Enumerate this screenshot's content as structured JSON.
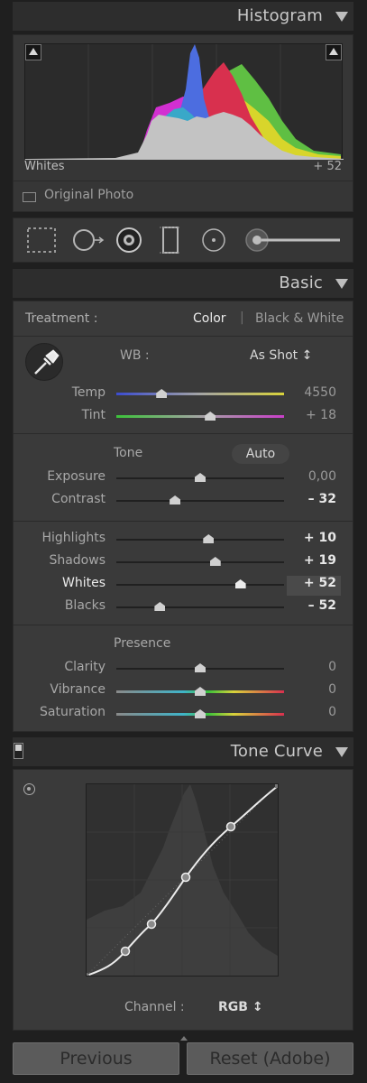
{
  "histogram": {
    "title": "Histogram",
    "info_label": "Whites",
    "info_value": "+ 52",
    "original_photo_label": "Original Photo"
  },
  "tools": [
    "crop-overlay-icon",
    "spot-removal-icon",
    "red-eye-icon",
    "graduated-filter-icon",
    "radial-filter-icon",
    "adjustment-brush-icon"
  ],
  "basic": {
    "title": "Basic",
    "treatment_label": "Treatment :",
    "treatment_color": "Color",
    "treatment_separator": "|",
    "treatment_bw": "Black & White",
    "wb_label": "WB :",
    "wb_value": "As Shot ↕",
    "tone_label": "Tone",
    "auto_label": "Auto",
    "presence_label": "Presence",
    "sliders": {
      "temp": {
        "label": "Temp",
        "value": "4550",
        "level": 0.27
      },
      "tint": {
        "label": "Tint",
        "value": "+ 18",
        "level": 0.56
      },
      "exposure": {
        "label": "Exposure",
        "value": "0,00",
        "level": 0.5
      },
      "contrast": {
        "label": "Contrast",
        "value": "– 32",
        "level": 0.35
      },
      "highlights": {
        "label": "Highlights",
        "value": "+ 10",
        "level": 0.55
      },
      "shadows": {
        "label": "Shadows",
        "value": "+ 19",
        "level": 0.59
      },
      "whites": {
        "label": "Whites",
        "value": "+ 52",
        "level": 0.74
      },
      "blacks": {
        "label": "Blacks",
        "value": "– 52",
        "level": 0.26
      },
      "clarity": {
        "label": "Clarity",
        "value": "0",
        "level": 0.5
      },
      "vibrance": {
        "label": "Vibrance",
        "value": "0",
        "level": 0.5
      },
      "saturation": {
        "label": "Saturation",
        "value": "0",
        "level": 0.5
      }
    }
  },
  "tone_curve": {
    "title": "Tone Curve",
    "channel_label": "Channel :",
    "channel_value": "RGB ↕"
  },
  "buttons": {
    "previous": "Previous",
    "reset": "Reset (Adobe)"
  },
  "colors": {
    "panel": "#3a3a3a",
    "header": "#2d2d2d",
    "background": "#1f1f1f"
  }
}
